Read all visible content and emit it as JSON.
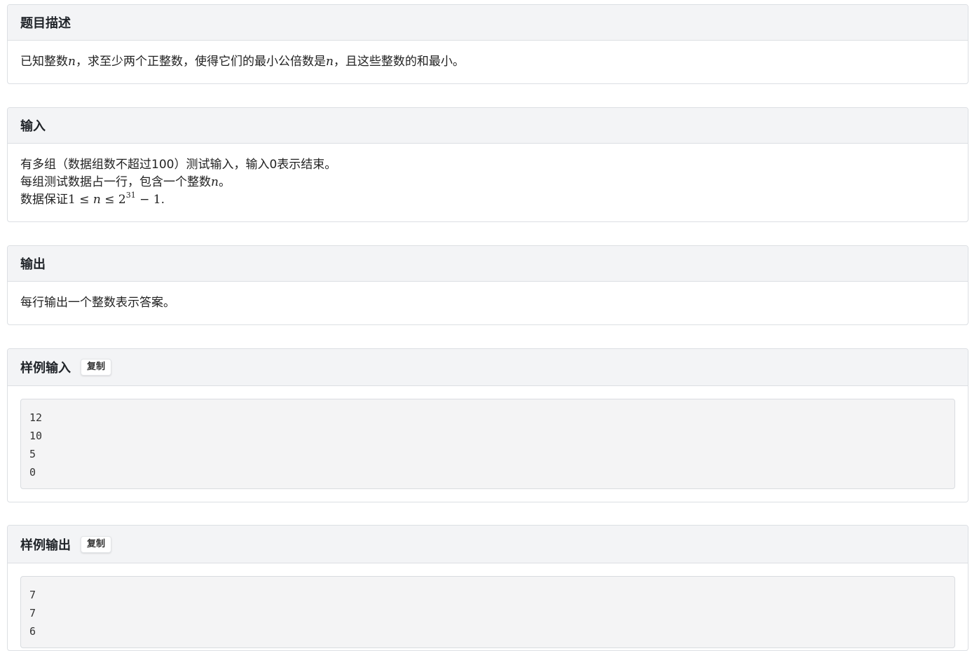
{
  "description": {
    "title": "题目描述",
    "text_part1": "已知整数",
    "var_n": "n",
    "text_part2": "，求至少两个正整数，使得它们的最小公倍数是",
    "text_part3": "，且这些整数的和最小。"
  },
  "input": {
    "title": "输入",
    "line1": "有多组（数据组数不超过100）测试输入，输入0表示结束。",
    "line2_part1": "每组测试数据占一行，包含一个整数",
    "line2_var": "n",
    "line2_part2": "。",
    "line3_part1": "数据保证",
    "line3_math_a": "1 ≤ ",
    "line3_math_n": "n",
    "line3_math_b": " ≤ 2",
    "line3_exp": "31",
    "line3_math_c": " − 1",
    "line3_end": "."
  },
  "output": {
    "title": "输出",
    "text": "每行输出一个整数表示答案。"
  },
  "sample_input": {
    "title": "样例输入",
    "copy_label": "复制",
    "lines": [
      "12",
      "10",
      "5",
      "0"
    ]
  },
  "sample_output": {
    "title": "样例输出",
    "copy_label": "复制",
    "lines": [
      "7",
      "7",
      "6"
    ]
  }
}
